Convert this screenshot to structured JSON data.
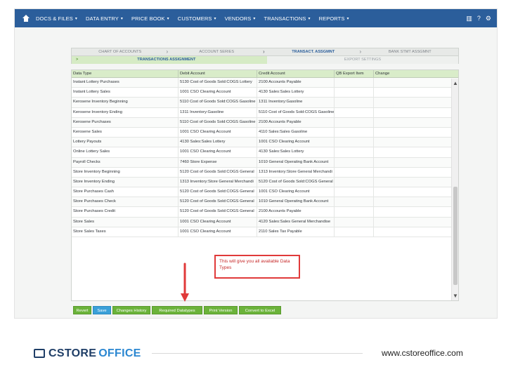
{
  "nav": {
    "items": [
      "DOCS & FILES",
      "DATA ENTRY",
      "PRICE BOOK",
      "CUSTOMERS",
      "VENDORS",
      "TRANSACTIONS",
      "REPORTS"
    ],
    "caret": "▾",
    "right_icons": [
      "▥",
      "?",
      "⚙"
    ]
  },
  "tabs": [
    "CHART OF ACCOUNTS",
    "ACCOUNT SERIES",
    "TRANSACT. ASSGMNT",
    "BANK STMT ASSGMNT"
  ],
  "subtabs": {
    "chevron": ">",
    "active": "TRANSACTIONS ASSIGNMENT",
    "other": "EXPORT SETTINGS"
  },
  "table": {
    "headers": [
      "Data Type",
      "Debit Account",
      "Credit Account",
      "QB Export Item",
      "Change"
    ],
    "rows": [
      [
        "Instant Lottery Purchases",
        "5130 Cost of Goods Sold:COGS Lottery",
        "2100 Accounts Payable"
      ],
      [
        "Instant Lottery Sales",
        "1001 CSO Clearing Account",
        "4130 Sales:Sales Lottery"
      ],
      [
        "Kerosene Inventory Beginning",
        "5110 Cost of Goods Sold:COGS Gasoline",
        "1311 Inventory:Gasoline"
      ],
      [
        "Kerosene Inventory Ending",
        "1311 Inventory:Gasoline",
        "5110 Cost of Goods Sold:COGS Gasoline"
      ],
      [
        "Kerosene Purchases",
        "5110 Cost of Goods Sold:COGS Gasoline",
        "2100 Accounts Payable"
      ],
      [
        "Kerosene Sales",
        "1001 CSO Clearing Account",
        "4110 Sales:Sales Gasoline"
      ],
      [
        "Lottery Payouts",
        "4130 Sales:Sales Lottery",
        "1001 CSO Clearing Account"
      ],
      [
        "Online Lottery Sales",
        "1001 CSO Clearing Account",
        "4130 Sales:Sales Lottery"
      ],
      [
        "Payroll Checks",
        "7460 Store Expense",
        "1010 General Operating Bank Account"
      ],
      [
        "Store Inventory Beginning",
        "5120 Cost of Goods Sold:COGS General",
        "1313 Inventory:Store General Merchandi"
      ],
      [
        "Store Inventory Ending",
        "1313 Inventory:Store General Merchandi",
        "5120 Cost of Goods Sold:COGS General"
      ],
      [
        "Store Purchases Cash",
        "5120 Cost of Goods Sold:COGS General",
        "1001 CSO Clearing Account"
      ],
      [
        "Store Purchases Check",
        "5120 Cost of Goods Sold:COGS General",
        "1010 General Operating Bank Account"
      ],
      [
        "Store Purchases Credit",
        "5120 Cost of Goods Sold:COGS General",
        "2100 Accounts Payable"
      ],
      [
        "Store Sales",
        "1001 CSO Clearing Account",
        "4120 Sales:Sales General Merchandise"
      ],
      [
        "Store Sales Taxes",
        "1001 CSO Clearing Account",
        "2110 Sales Tax Payable"
      ]
    ]
  },
  "scroll": {
    "up": "▲",
    "down": "▼"
  },
  "callout": "This will give you all available Data Types",
  "buttons": [
    "Revert",
    "Save",
    "Changes History",
    "Required Datatypes",
    "Print Version",
    "Convert to Excel"
  ],
  "colors": {
    "nav": "#2b5e9b",
    "button_green": "#6bb33a",
    "button_blue": "#3ba0d8",
    "callout_red": "#e03a3a"
  },
  "footer": {
    "logo_part1": "CSTORE",
    "logo_part2": "OFFICE",
    "url": "www.cstoreoffice.com"
  }
}
